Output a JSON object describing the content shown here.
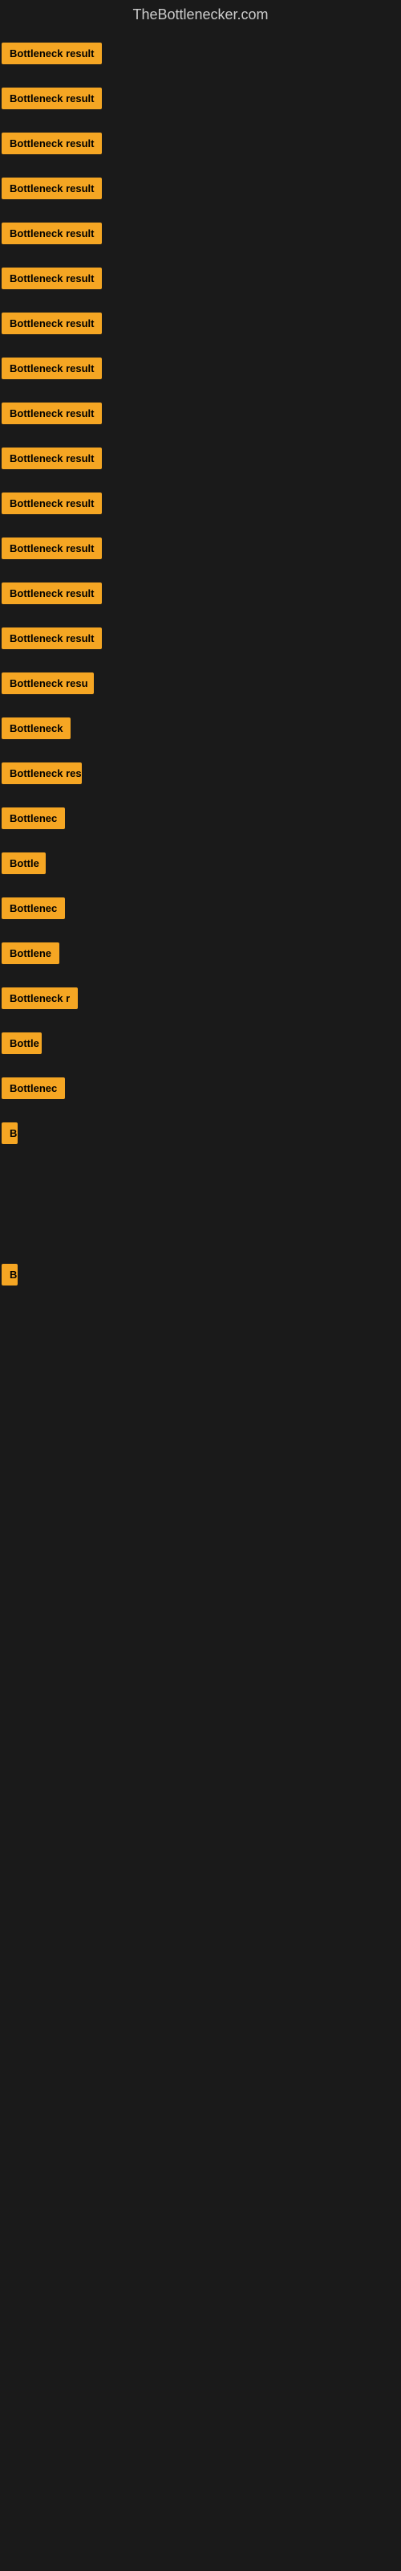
{
  "site": {
    "title": "TheBottlenecker.com"
  },
  "accent_color": "#f5a623",
  "rows": [
    {
      "id": 1,
      "label": "Bottleneck result",
      "visible_text": "Bottleneck result"
    },
    {
      "id": 2,
      "label": "Bottleneck result",
      "visible_text": "Bottleneck result"
    },
    {
      "id": 3,
      "label": "Bottleneck result",
      "visible_text": "Bottleneck result"
    },
    {
      "id": 4,
      "label": "Bottleneck result",
      "visible_text": "Bottleneck result"
    },
    {
      "id": 5,
      "label": "Bottleneck result",
      "visible_text": "Bottleneck result"
    },
    {
      "id": 6,
      "label": "Bottleneck result",
      "visible_text": "Bottleneck result"
    },
    {
      "id": 7,
      "label": "Bottleneck result",
      "visible_text": "Bottleneck result"
    },
    {
      "id": 8,
      "label": "Bottleneck result",
      "visible_text": "Bottleneck result"
    },
    {
      "id": 9,
      "label": "Bottleneck result",
      "visible_text": "Bottleneck result"
    },
    {
      "id": 10,
      "label": "Bottleneck result",
      "visible_text": "Bottleneck result"
    },
    {
      "id": 11,
      "label": "Bottleneck result",
      "visible_text": "Bottleneck result"
    },
    {
      "id": 12,
      "label": "Bottleneck result",
      "visible_text": "Bottleneck result"
    },
    {
      "id": 13,
      "label": "Bottleneck result",
      "visible_text": "Bottleneck result"
    },
    {
      "id": 14,
      "label": "Bottleneck result",
      "visible_text": "Bottleneck result"
    },
    {
      "id": 15,
      "label": "Bottleneck resu",
      "visible_text": "Bottleneck resu"
    },
    {
      "id": 16,
      "label": "Bottleneck",
      "visible_text": "Bottleneck"
    },
    {
      "id": 17,
      "label": "Bottleneck res",
      "visible_text": "Bottleneck res"
    },
    {
      "id": 18,
      "label": "Bottlenec",
      "visible_text": "Bottlenec"
    },
    {
      "id": 19,
      "label": "Bottle",
      "visible_text": "Bottle"
    },
    {
      "id": 20,
      "label": "Bottlenec",
      "visible_text": "Bottlenec"
    },
    {
      "id": 21,
      "label": "Bottlene",
      "visible_text": "Bottlene"
    },
    {
      "id": 22,
      "label": "Bottleneck r",
      "visible_text": "Bottleneck r"
    },
    {
      "id": 23,
      "label": "Bottle",
      "visible_text": "Bottle"
    },
    {
      "id": 24,
      "label": "Bottlenec",
      "visible_text": "Bottlenec"
    },
    {
      "id": 25,
      "label": "B",
      "visible_text": "B"
    },
    {
      "id": 26,
      "label": "B",
      "visible_text": "B"
    }
  ]
}
